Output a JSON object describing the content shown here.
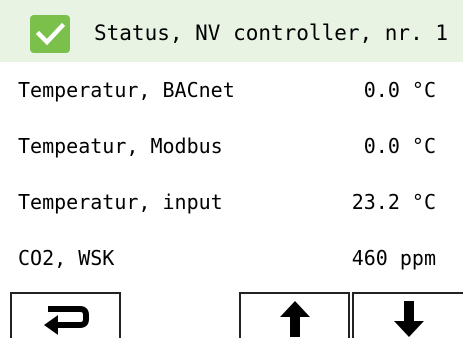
{
  "header": {
    "title": "Status, NV controller, nr. 1",
    "status_icon": "checkmark-icon",
    "status_color": "#7cc04c",
    "background": "#e9f3e4"
  },
  "rows": [
    {
      "label": "Temperatur, BACnet",
      "value": "0.0 °C"
    },
    {
      "label": "Tempeatur, Modbus",
      "value": "0.0 °C"
    },
    {
      "label": "Temperatur, input",
      "value": "23.2 °C"
    },
    {
      "label": "CO2, WSK",
      "value": "460 ppm"
    }
  ],
  "buttons": {
    "back_icon": "return-arrow-icon",
    "up_icon": "arrow-up-icon",
    "down_icon": "arrow-down-icon"
  }
}
